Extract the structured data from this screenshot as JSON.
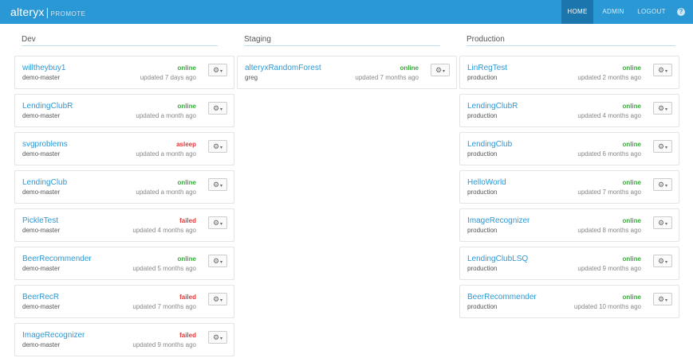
{
  "navbar": {
    "brand": "alteryx",
    "separator": "|",
    "product": "PROMOTE",
    "items": [
      {
        "label": "HOME",
        "active": true
      },
      {
        "label": "ADMIN",
        "active": false
      },
      {
        "label": "LOGOUT",
        "active": false
      }
    ],
    "help_icon": "question-circle-icon",
    "help_glyph": "?"
  },
  "columns": [
    {
      "title": "Dev",
      "models": [
        {
          "name": "willtheybuy1",
          "branch": "demo-master",
          "status": "online",
          "updated": "updated 7 days ago"
        },
        {
          "name": "LendingClubR",
          "branch": "demo-master",
          "status": "online",
          "updated": "updated a month ago"
        },
        {
          "name": "svgproblems",
          "branch": "demo-master",
          "status": "asleep",
          "updated": "updated a month ago"
        },
        {
          "name": "LendingClub",
          "branch": "demo-master",
          "status": "online",
          "updated": "updated a month ago"
        },
        {
          "name": "PickleTest",
          "branch": "demo-master",
          "status": "failed",
          "updated": "updated 4 months ago"
        },
        {
          "name": "BeerRecommender",
          "branch": "demo-master",
          "status": "online",
          "updated": "updated 5 months ago"
        },
        {
          "name": "BeerRecR",
          "branch": "demo-master",
          "status": "failed",
          "updated": "updated 7 months ago"
        },
        {
          "name": "ImageRecognizer",
          "branch": "demo-master",
          "status": "failed",
          "updated": "updated 9 months ago"
        }
      ]
    },
    {
      "title": "Staging",
      "models": [
        {
          "name": "alteryxRandomForest",
          "branch": "greg",
          "status": "online",
          "updated": "updated 7 months ago"
        }
      ]
    },
    {
      "title": "Production",
      "models": [
        {
          "name": "LinRegTest",
          "branch": "production",
          "status": "online",
          "updated": "updated 2 months ago"
        },
        {
          "name": "LendingClubR",
          "branch": "production",
          "status": "online",
          "updated": "updated 4 months ago"
        },
        {
          "name": "LendingClub",
          "branch": "production",
          "status": "online",
          "updated": "updated 6 months ago"
        },
        {
          "name": "HelloWorld",
          "branch": "production",
          "status": "online",
          "updated": "updated 7 months ago"
        },
        {
          "name": "ImageRecognizer",
          "branch": "production",
          "status": "online",
          "updated": "updated 8 months ago"
        },
        {
          "name": "LendingClubLSQ",
          "branch": "production",
          "status": "online",
          "updated": "updated 9 months ago"
        },
        {
          "name": "BeerRecommender",
          "branch": "production",
          "status": "online",
          "updated": "updated 10 months ago"
        }
      ]
    }
  ],
  "gear_button": {
    "icon": "gear-icon",
    "glyph": "⚙",
    "caret_icon": "caret-down-icon",
    "caret_glyph": "▾"
  },
  "colors": {
    "accent": "#2a98d4",
    "nav_active": "#1a76ac",
    "online": "#3ea63e",
    "failed": "#e03a3a",
    "asleep": "#e03a3a"
  }
}
